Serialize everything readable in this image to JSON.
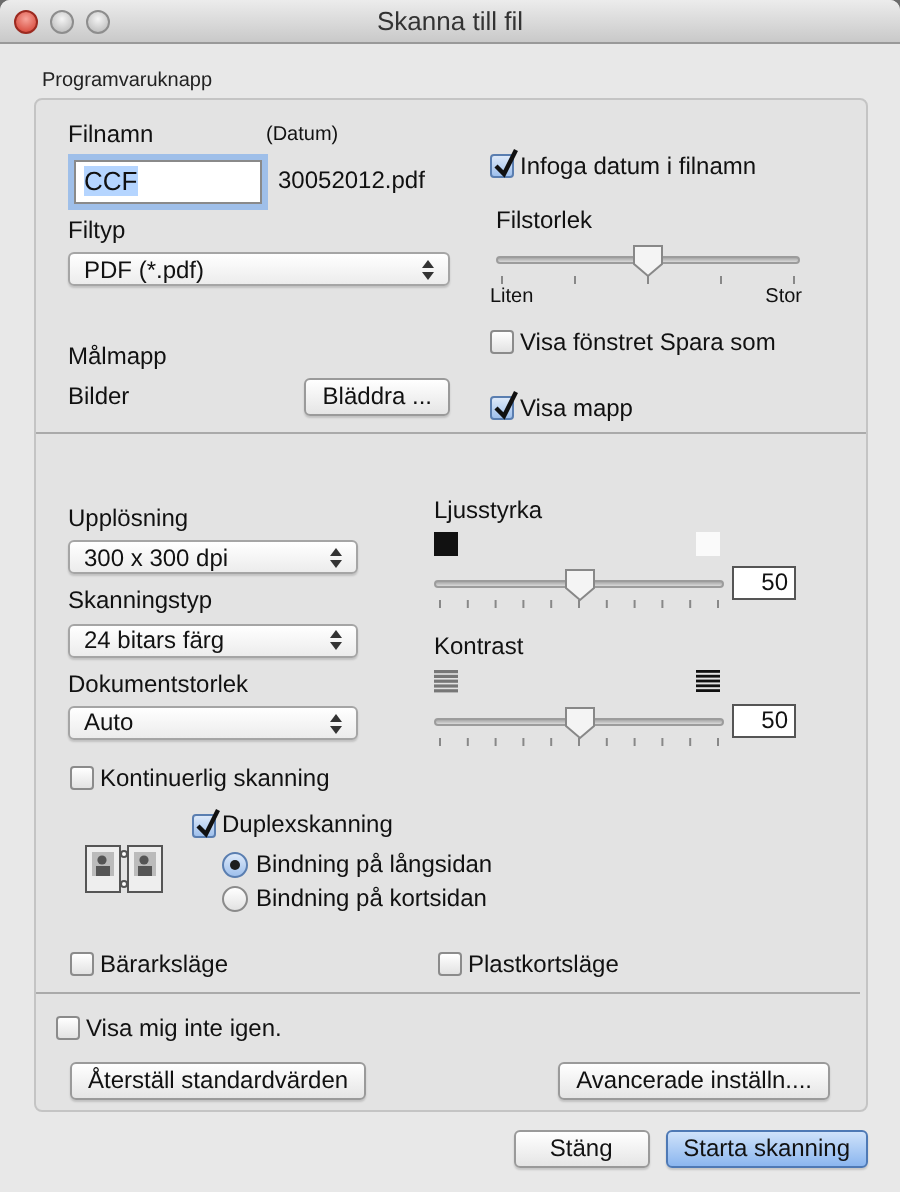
{
  "window": {
    "title": "Skanna till fil"
  },
  "group": {
    "label": "Programvaruknapp"
  },
  "file_name": {
    "label": "Filnamn",
    "date_label": "(Datum)",
    "value": "CCF",
    "date_suffix": "30052012.pdf"
  },
  "insert_date": {
    "label": "Infoga datum i filnamn",
    "checked": true
  },
  "file_type": {
    "label": "Filtyp",
    "value": "PDF (*.pdf)"
  },
  "file_size": {
    "label": "Filstorlek",
    "level": 0.5,
    "min_label": "Liten",
    "max_label": "Stor"
  },
  "destination": {
    "label": "Målmapp",
    "folder": "Bilder",
    "browse_button": "Bläddra ..."
  },
  "show_save_as": {
    "label": "Visa fönstret Spara som",
    "checked": false
  },
  "show_folder": {
    "label": "Visa mapp",
    "checked": true
  },
  "selects": [
    {
      "label": "Upplösning",
      "value": "300 x 300 dpi"
    },
    {
      "label": "Skanningstyp",
      "value": "24 bitars färg"
    },
    {
      "label": "Dokumentstorlek",
      "value": "Auto"
    }
  ],
  "adjustments": [
    {
      "kind": "brightness",
      "label": "Ljusstyrka",
      "level": 0.5,
      "reading": "50"
    },
    {
      "kind": "contrast",
      "label": "Kontrast",
      "level": 0.5,
      "reading": "50"
    }
  ],
  "continuous_scan": {
    "label": "Kontinuerlig skanning",
    "checked": false
  },
  "duplex": {
    "label": "Duplexskanning",
    "checked": true,
    "options": [
      {
        "label": "Bindning på långsidan",
        "selected": true
      },
      {
        "label": "Bindning på kortsidan",
        "selected": false
      }
    ]
  },
  "carrier_sheet": {
    "label": "Bärarksläge",
    "checked": false
  },
  "plastic_card": {
    "label": "Plastkortsläge",
    "checked": false
  },
  "dont_show_again": {
    "label": "Visa mig inte igen.",
    "checked": false
  },
  "reset_button": "Återställ standardvärden",
  "advanced_button": "Avancerade inställn....",
  "buttons": [
    {
      "label": "Stäng",
      "default": false
    },
    {
      "label": "Starta skanning",
      "default": true
    }
  ]
}
